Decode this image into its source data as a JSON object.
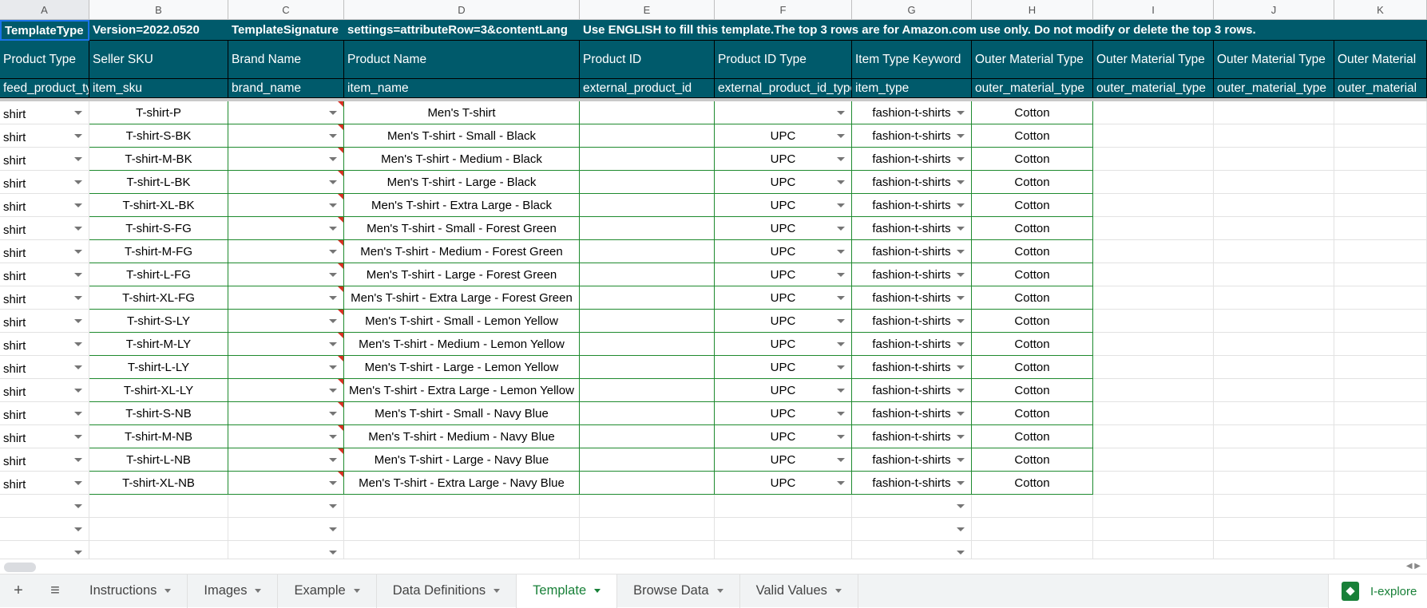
{
  "columns": [
    "A",
    "B",
    "C",
    "D",
    "E",
    "F",
    "G",
    "H",
    "I",
    "J",
    "K"
  ],
  "row1": {
    "a": "TemplateType",
    "b": "Version=2022.0520",
    "c": "TemplateSignature",
    "d": "settings=attributeRow=3&contentLang",
    "e": "Use ENGLISH to fill this template.The top 3 rows are for Amazon.com use only. Do not modify or delete the top 3 rows."
  },
  "row2": [
    "Product Type",
    "Seller SKU",
    "Brand Name",
    "Product Name",
    "Product ID",
    "Product ID Type",
    "Item Type Keyword",
    "Outer Material Type",
    "Outer Material Type",
    "Outer Material Type",
    "Outer Material"
  ],
  "row3": [
    "feed_product_type",
    "item_sku",
    "brand_name",
    "item_name",
    "external_product_id",
    "external_product_id_type",
    "item_type",
    "outer_material_type",
    "outer_material_type",
    "outer_material_type",
    "outer_material"
  ],
  "rows": [
    {
      "type": "shirt",
      "sku": "T-shirt-P",
      "name": "Men's T-shirt",
      "idtype": "",
      "keyword": "fashion-t-shirts",
      "material": "Cotton"
    },
    {
      "type": "shirt",
      "sku": "T-shirt-S-BK",
      "name": "Men's T-shirt - Small - Black",
      "idtype": "UPC",
      "keyword": "fashion-t-shirts",
      "material": "Cotton"
    },
    {
      "type": "shirt",
      "sku": "T-shirt-M-BK",
      "name": "Men's T-shirt - Medium - Black",
      "idtype": "UPC",
      "keyword": "fashion-t-shirts",
      "material": "Cotton"
    },
    {
      "type": "shirt",
      "sku": "T-shirt-L-BK",
      "name": "Men's T-shirt - Large - Black",
      "idtype": "UPC",
      "keyword": "fashion-t-shirts",
      "material": "Cotton"
    },
    {
      "type": "shirt",
      "sku": "T-shirt-XL-BK",
      "name": "Men's T-shirt - Extra Large - Black",
      "idtype": "UPC",
      "keyword": "fashion-t-shirts",
      "material": "Cotton"
    },
    {
      "type": "shirt",
      "sku": "T-shirt-S-FG",
      "name": "Men's T-shirt - Small - Forest Green",
      "idtype": "UPC",
      "keyword": "fashion-t-shirts",
      "material": "Cotton"
    },
    {
      "type": "shirt",
      "sku": "T-shirt-M-FG",
      "name": "Men's T-shirt - Medium - Forest Green",
      "idtype": "UPC",
      "keyword": "fashion-t-shirts",
      "material": "Cotton"
    },
    {
      "type": "shirt",
      "sku": "T-shirt-L-FG",
      "name": "Men's T-shirt - Large - Forest Green",
      "idtype": "UPC",
      "keyword": "fashion-t-shirts",
      "material": "Cotton"
    },
    {
      "type": "shirt",
      "sku": "T-shirt-XL-FG",
      "name": "Men's T-shirt - Extra Large - Forest Green",
      "idtype": "UPC",
      "keyword": "fashion-t-shirts",
      "material": "Cotton"
    },
    {
      "type": "shirt",
      "sku": "T-shirt-S-LY",
      "name": "Men's T-shirt - Small - Lemon Yellow",
      "idtype": "UPC",
      "keyword": "fashion-t-shirts",
      "material": "Cotton"
    },
    {
      "type": "shirt",
      "sku": "T-shirt-M-LY",
      "name": "Men's T-shirt - Medium - Lemon Yellow",
      "idtype": "UPC",
      "keyword": "fashion-t-shirts",
      "material": "Cotton"
    },
    {
      "type": "shirt",
      "sku": "T-shirt-L-LY",
      "name": "Men's T-shirt - Large - Lemon Yellow",
      "idtype": "UPC",
      "keyword": "fashion-t-shirts",
      "material": "Cotton"
    },
    {
      "type": "shirt",
      "sku": "T-shirt-XL-LY",
      "name": "Men's T-shirt - Extra Large - Lemon Yellow",
      "idtype": "UPC",
      "keyword": "fashion-t-shirts",
      "material": "Cotton"
    },
    {
      "type": "shirt",
      "sku": "T-shirt-S-NB",
      "name": "Men's T-shirt - Small - Navy Blue",
      "idtype": "UPC",
      "keyword": "fashion-t-shirts",
      "material": "Cotton"
    },
    {
      "type": "shirt",
      "sku": "T-shirt-M-NB",
      "name": "Men's T-shirt - Medium - Navy Blue",
      "idtype": "UPC",
      "keyword": "fashion-t-shirts",
      "material": "Cotton"
    },
    {
      "type": "shirt",
      "sku": "T-shirt-L-NB",
      "name": "Men's T-shirt - Large - Navy Blue",
      "idtype": "UPC",
      "keyword": "fashion-t-shirts",
      "material": "Cotton"
    },
    {
      "type": "shirt",
      "sku": "T-shirt-XL-NB",
      "name": "Men's T-shirt - Extra Large - Navy Blue",
      "idtype": "UPC",
      "keyword": "fashion-t-shirts",
      "material": "Cotton"
    }
  ],
  "tabs": [
    "Instructions",
    "Images",
    "Example",
    "Data Definitions",
    "Template",
    "Browse Data",
    "Valid Values"
  ],
  "active_tab": "Template",
  "explore_label": "I-explore",
  "colors": {
    "header_bg": "#005a6b",
    "active_tab": "#188038",
    "border_green": "#1e8a2e"
  }
}
